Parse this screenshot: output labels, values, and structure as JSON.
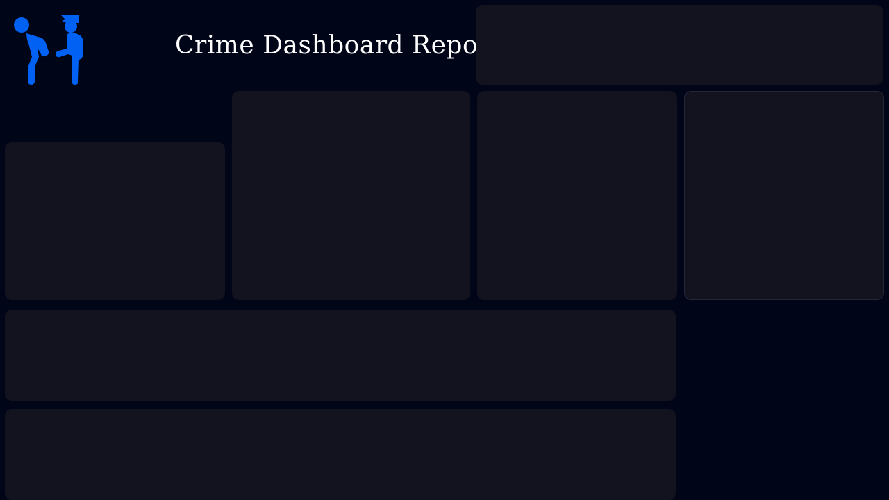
{
  "header": {
    "title": "Crime Dashboard Report",
    "logo_icon": "arrest-police-officer-icon"
  },
  "colors": {
    "background": "#000518",
    "panel": "#13121f",
    "accent": "#0061f2",
    "title_text": "#ffffff"
  },
  "panels": {
    "top_right": "",
    "middle_left": "",
    "middle_center_left": "",
    "middle_center_right": "",
    "middle_right": "",
    "bottom_wide_1": "",
    "bottom_wide_2": ""
  }
}
